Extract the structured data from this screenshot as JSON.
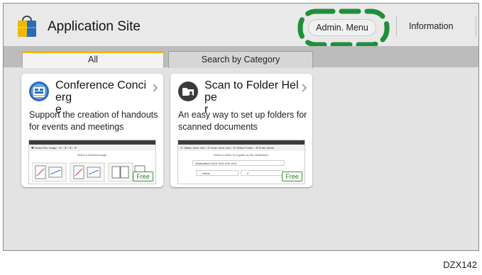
{
  "header": {
    "app_title": "Application Site",
    "admin_menu": "Admin. Menu",
    "information": "Information",
    "app_icon": "shopping-bag-icon"
  },
  "tabs": [
    {
      "label": "All",
      "active": true
    },
    {
      "label": "Search by Category",
      "active": false
    }
  ],
  "cards": [
    {
      "title": "Conference Concierge",
      "title_line1": "Conference Concierg",
      "title_line2": "e",
      "description_line1": "Support the creation of handouts",
      "description_line2": "for events and meetings",
      "badge": "Free",
      "icon": "presentation-board-icon",
      "preview": {
        "steps": "❶ Select File Image  ›  ②  ›  ③  ›  ④  ›  ⑤",
        "caption": "Select a finished image."
      }
    },
    {
      "title": "Scan to Folder Helper",
      "title_line1": "Scan to Folder Helpe",
      "title_line2": "r",
      "description_line1": "An easy way to set up folders for",
      "description_line2": "scanned documents",
      "badge": "Free",
      "icon": "folder-user-icon",
      "preview": {
        "steps": "① Obtain Dest. Info › ② Enter Dest. Info › ③ Select Folder › ④ Enter Name",
        "caption": "Select a folder to register as the destination.",
        "destination_label": "Destination",
        "destination_value": "\\\\XXX.XXX.XXX.XXX",
        "folder_1": "Home",
        "folder_2": "0"
      }
    }
  ],
  "footer_code": "DZX142",
  "colors": {
    "tab_accent": "#f0b800",
    "highlight": "#1f8f3a",
    "free_badge": "#2b7a2b"
  }
}
